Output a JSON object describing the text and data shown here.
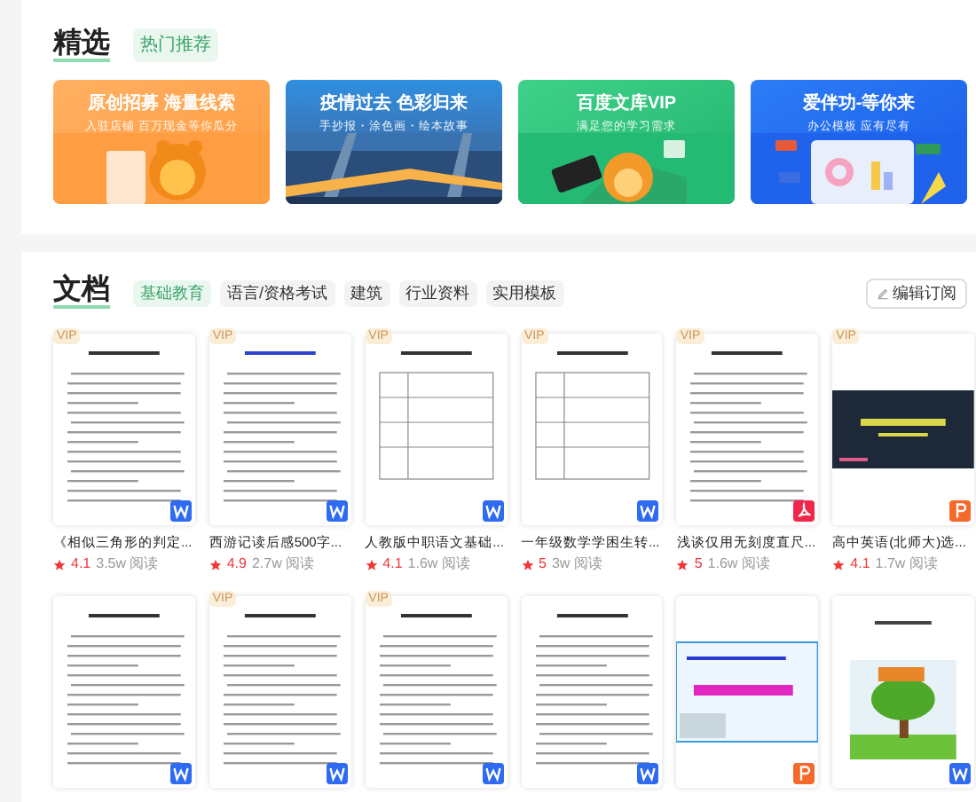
{
  "featured": {
    "title": "精选",
    "badge": "热门推荐",
    "banners": [
      {
        "title": "原创招募 海量线索",
        "subtitle": "入驻店铺 百万现金等你瓜分"
      },
      {
        "title": "疫情过去 色彩归来",
        "subtitle": "手抄报・涂色画・绘本故事"
      },
      {
        "title": "百度文库VIP",
        "subtitle": "满足您的学习需求"
      },
      {
        "title": "爱伴功-等你来",
        "subtitle": "办公模板 应有尽有"
      }
    ]
  },
  "documents": {
    "title": "文档",
    "tabs": [
      {
        "label": "基础教育",
        "selected": true
      },
      {
        "label": "语言/资格考试",
        "selected": false
      },
      {
        "label": "建筑",
        "selected": false
      },
      {
        "label": "行业资料",
        "selected": false
      },
      {
        "label": "实用模板",
        "selected": false
      }
    ],
    "subscribe_button": "编辑订阅",
    "items": [
      {
        "badge": "VIP",
        "kind": "word",
        "title": "《相似三角形的判定...",
        "rating": "4.1",
        "reads": "3.5w 阅读"
      },
      {
        "badge": "VIP",
        "kind": "word",
        "title": "西游记读后感500字...",
        "rating": "4.9",
        "reads": "2.7w 阅读"
      },
      {
        "badge": "VIP",
        "kind": "word",
        "title": "人教版中职语文基础...",
        "rating": "4.1",
        "reads": "1.6w 阅读"
      },
      {
        "badge": "VIP",
        "kind": "word",
        "title": "一年级数学学困生转...",
        "rating": "5",
        "reads": "3w 阅读"
      },
      {
        "badge": "VIP",
        "kind": "pdf",
        "title": "浅谈仅用无刻度直尺...",
        "rating": "5",
        "reads": "1.6w 阅读"
      },
      {
        "badge": "VIP",
        "kind": "ppt",
        "title": "高中英语(北师大)选...",
        "rating": "4.1",
        "reads": "1.7w 阅读"
      },
      {
        "kind": "word"
      },
      {
        "badge": "VIP",
        "kind": "word"
      },
      {
        "badge": "VIP",
        "kind": "word"
      },
      {
        "kind": "word"
      },
      {
        "kind": "ppt"
      },
      {
        "kind": "word"
      }
    ]
  }
}
